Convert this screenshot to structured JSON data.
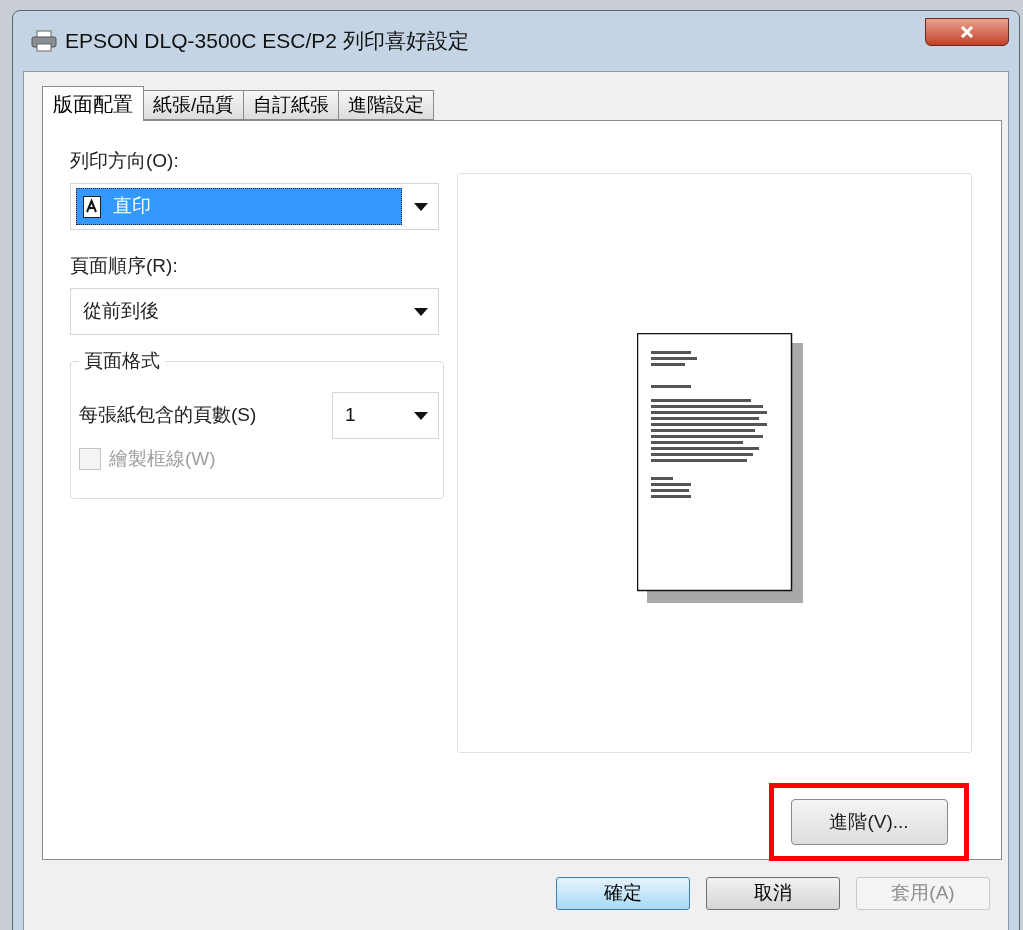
{
  "window": {
    "title": "EPSON DLQ-3500C ESC/P2 列印喜好設定"
  },
  "tabs": [
    {
      "label": "版面配置",
      "selected": true
    },
    {
      "label": "紙張/品質",
      "selected": false
    },
    {
      "label": "自訂紙張",
      "selected": false
    },
    {
      "label": "進階設定",
      "selected": false
    }
  ],
  "orientation": {
    "label": "列印方向(O):",
    "value": "直印",
    "highlighted": true
  },
  "page_order": {
    "label": "頁面順序(R):",
    "value": "從前到後"
  },
  "page_format": {
    "title": "頁面格式",
    "pages_per_sheet": {
      "label": "每張紙包含的頁數(S)",
      "value": "1"
    },
    "draw_borders": {
      "label": "繪製框線(W)",
      "checked": false,
      "disabled": true
    }
  },
  "advanced_button": {
    "label": "進階(V)...",
    "highlighted": true
  },
  "buttons": [
    {
      "label": "確定",
      "kind": "default"
    },
    {
      "label": "取消",
      "kind": "normal"
    },
    {
      "label": "套用(A)",
      "kind": "disabled"
    }
  ]
}
